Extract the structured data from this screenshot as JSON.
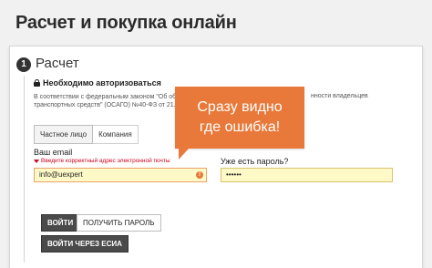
{
  "page": {
    "title": "Расчет и покупка онлайн"
  },
  "step": {
    "number": "1",
    "title": "Расчет"
  },
  "auth": {
    "heading": "Необходимо авторизоваться",
    "law_text_line1": "В соответствии с федеральным законом \"Об обяза",
    "law_text_line1_tail": "нности владельцев",
    "law_text_line2": "транспортных средств\" (ОСАГО) №40-ФЗ от 21.07.2"
  },
  "tabs": [
    {
      "label": "Частное лицо",
      "active": true
    },
    {
      "label": "Компания",
      "active": false
    }
  ],
  "email": {
    "label": "Ваш email",
    "error": "Введите корректный адрес электронной почты",
    "value": "info@uexpert"
  },
  "password": {
    "label": "Уже есть пароль?",
    "value": "••••••"
  },
  "buttons": {
    "login": "ВОЙТИ",
    "get_password": "ПОЛУЧИТЬ ПАРОЛЬ",
    "login_esia": "ВОЙТИ ЧЕРЕЗ ЕСИА"
  },
  "callout": {
    "line1": "Сразу видно",
    "line2": "где ошибка!"
  },
  "colors": {
    "accent": "#e8793a",
    "error": "#d0021b",
    "field_highlight": "#fff9c8"
  }
}
